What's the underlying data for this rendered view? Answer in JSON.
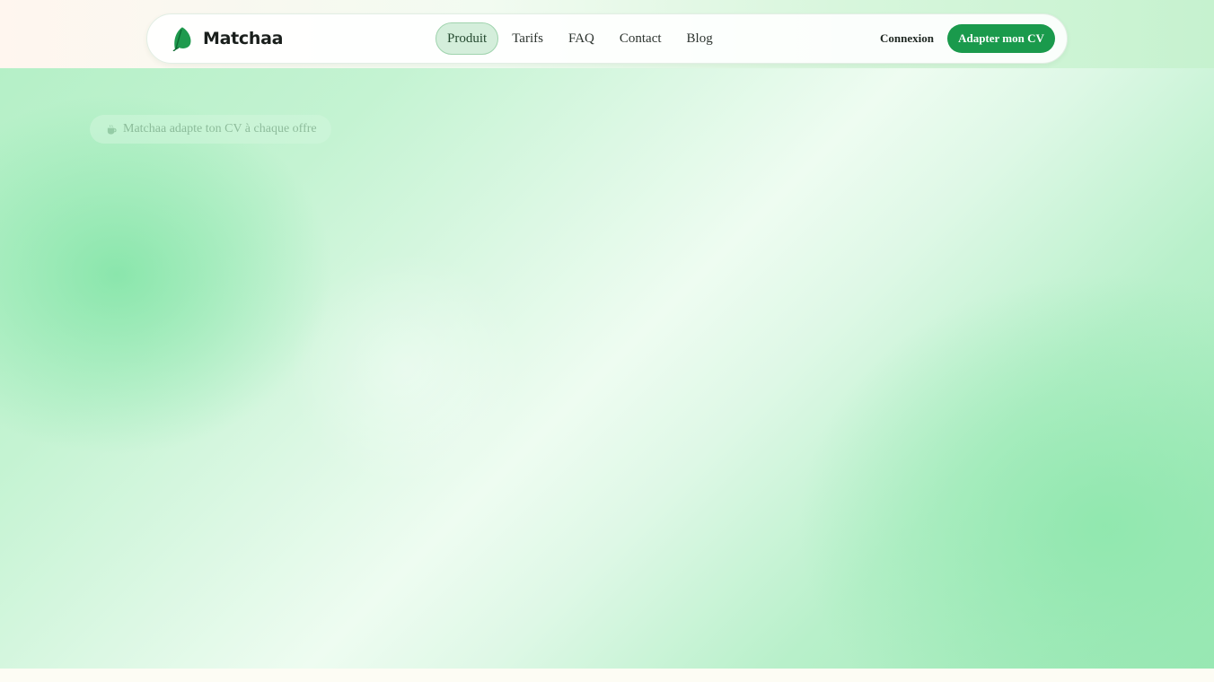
{
  "brand": {
    "name": "Matchaa",
    "logo_icon": "leaf-icon",
    "accent_color": "#1a9a4c"
  },
  "nav": {
    "items": [
      {
        "label": "Produit",
        "active": true
      },
      {
        "label": "Tarifs",
        "active": false
      },
      {
        "label": "FAQ",
        "active": false
      },
      {
        "label": "Contact",
        "active": false
      },
      {
        "label": "Blog",
        "active": false
      }
    ],
    "login_label": "Connexion",
    "cta_label": "Adapter mon CV"
  },
  "hero": {
    "badge_icon": "tea-cup-icon",
    "badge_text": "Matchaa adapte ton CV à chaque offre"
  }
}
